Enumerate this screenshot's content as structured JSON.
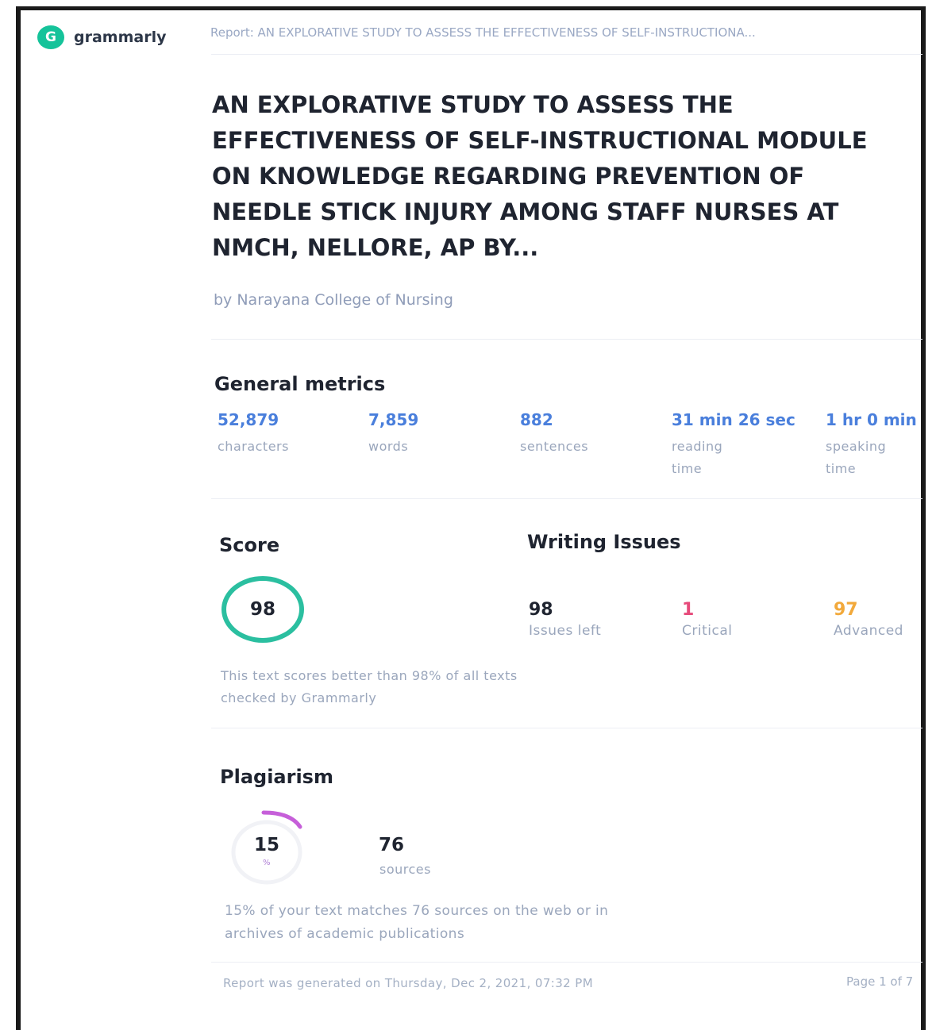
{
  "header": {
    "logo_text": "grammarly",
    "breadcrumb": "Report: AN EXPLORATIVE STUDY TO ASSESS THE EFFECTIVENESS OF SELF-INSTRUCTIONA..."
  },
  "document": {
    "title": "AN EXPLORATIVE STUDY TO ASSESS THE EFFECTIVENESS OF SELF-INSTRUCTIONAL MODULE ON KNOWLEDGE REGARDING PREVENTION OF NEEDLE STICK INJURY AMONG STAFF NURSES AT NMCH, NELLORE, AP BY...",
    "author": "by Narayana College of Nursing"
  },
  "general_metrics": {
    "title": "General metrics",
    "items": [
      {
        "value": "52,879",
        "label": "characters"
      },
      {
        "value": "7,859",
        "label": "words"
      },
      {
        "value": "882",
        "label": "sentences"
      },
      {
        "value": "31 min 26 sec",
        "label": "reading time"
      },
      {
        "value": "1 hr 0 min",
        "label": "speaking time"
      }
    ]
  },
  "score": {
    "title": "Score",
    "value": "98",
    "description": "This text scores better than 98% of all texts checked by Grammarly"
  },
  "writing_issues": {
    "title": "Writing Issues",
    "items": [
      {
        "value": "98",
        "label": "Issues left",
        "color": "#1f2430"
      },
      {
        "value": "1",
        "label": "Critical",
        "color": "#e64a7a"
      },
      {
        "value": "97",
        "label": "Advanced",
        "color": "#f2a93b"
      }
    ]
  },
  "plagiarism": {
    "title": "Plagiarism",
    "percent": "15",
    "percent_unit": "%",
    "sources_value": "76",
    "sources_label": "sources",
    "description": "15% of your text matches 76 sources on the web or in archives of academic publications",
    "ring_color": "#c65fd9"
  },
  "footer": {
    "generated": "Report was generated on Thursday, Dec 2, 2021, 07:32 PM",
    "page": "Page 1 of 7"
  },
  "colors": {
    "brand": "#15c39a",
    "metric_value": "#4a7fdc",
    "score_ring": "#2bbfa0"
  }
}
